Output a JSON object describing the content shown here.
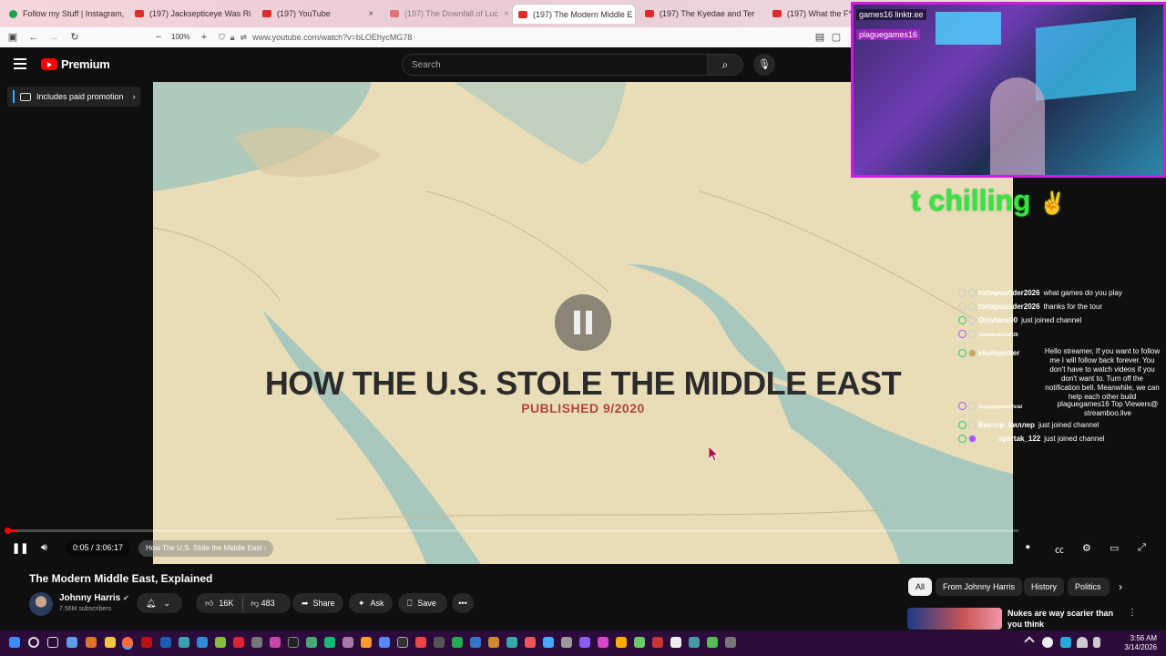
{
  "browser": {
    "tabs": [
      {
        "label": "Follow my Stuff | Instagram, Tik",
        "fav": "green"
      },
      {
        "label": "(197) Jacksepticeye Was Ri",
        "fav": "red"
      },
      {
        "label": "(197) YouTube",
        "fav": "red"
      },
      {
        "label": "(197) The Downfall of Luc",
        "fav": "red"
      },
      {
        "label": "(197) The Modern Middle E",
        "fav": "red",
        "active": true
      },
      {
        "label": "(197) The Kyedae and Ter",
        "fav": "red"
      },
      {
        "label": "(197) What the F*CK is",
        "fav": "red"
      }
    ],
    "zoom": "100%",
    "url": "www.youtube.com/watch?v=bLOEhycMG78"
  },
  "youtube": {
    "logo_text": "Premium",
    "search_placeholder": "Search",
    "promo_label": "Includes paid promotion"
  },
  "video": {
    "overlay_title": "HOW THE U.S. STOLE THE MIDDLE EAST",
    "overlay_subtitle": "PUBLISHED 9/2020",
    "time": "0:05 / 3:06:17",
    "chapter": "How The U.S. Stole the Middle East",
    "progress": 0.0004,
    "title": "The Modern Middle East, Explained",
    "channel": "Johnny Harris",
    "subscribers": "7.56M subscribers",
    "likes": "16K",
    "dislikes": "483",
    "share_label": "Share",
    "ask_label": "Ask",
    "save_label": "Save"
  },
  "chips": [
    "All",
    "From Johnny Harris",
    "History",
    "Politics"
  ],
  "recommendation": {
    "title": "Nukes are way scarier than you think"
  },
  "stream": {
    "cam_tag_1": "games16 linktr.ee",
    "cam_tag_2": "plaguegames16",
    "chilling_text": "t chilling",
    "chat": [
      {
        "user": "tortapounder2026",
        "msg": "what games do you play"
      },
      {
        "user": "tortapounder2026",
        "msg": "thanks for the tour"
      },
      {
        "user": "Onlyfans90",
        "msg": "just joined channel"
      },
      {
        "user": "spravlenierus2026",
        "msg": ""
      },
      {
        "user": "skullspotter",
        "msg": "Hello streamer, If you want to follow"
      },
      {
        "user": "",
        "msg": "me I will follow back forever. You"
      },
      {
        "user": "",
        "msg": "don't have to watch videos if you"
      },
      {
        "user": "",
        "msg": "don't want to. Turn off the"
      },
      {
        "user": "",
        "msg": "notification bell. Meanwhile, we can"
      },
      {
        "user": "",
        "msg": "help each other build"
      },
      {
        "user": "plaguegamesofficial",
        "msg": "plaguegames16 Top Viewers@"
      },
      {
        "user": "",
        "msg": "streamboo.live"
      },
      {
        "user": "Виктор_Киллер",
        "msg": "just joined channel"
      },
      {
        "user": "spartak_122",
        "msg": "just joined channel"
      }
    ]
  },
  "taskbar": {
    "time": "3:56 AM",
    "date": "3/14/2026"
  }
}
